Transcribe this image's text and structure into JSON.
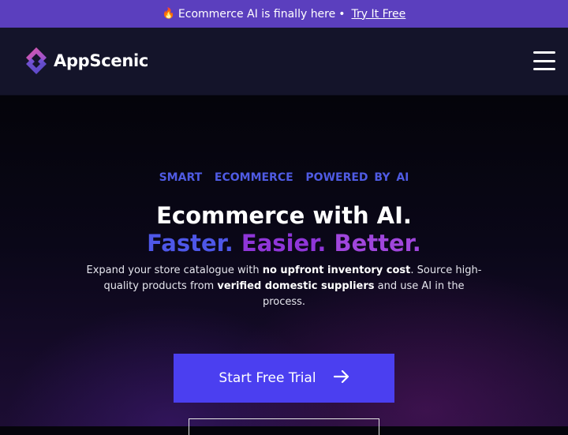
{
  "announcement": {
    "icon": "fire-icon",
    "text": "Ecommerce AI is finally here",
    "separator": "•",
    "link": "Try It Free"
  },
  "nav": {
    "brand": "AppScenic",
    "menu_icon": "hamburger-menu-icon"
  },
  "hero": {
    "eyebrow": "SMART  ECOMMERCE  POWERED BY AI",
    "headline": "Ecommerce with AI.",
    "tagline_1": "Faster.",
    "tagline_2": "Easier.",
    "tagline_3": "Better.",
    "desc_1": "Expand your store catalogue with ",
    "desc_bold_1": "no upfront inventory cost",
    "desc_2": ". Source high-quality products from ",
    "desc_bold_2": "verified domestic suppliers",
    "desc_3": " and use AI in the process.",
    "cta_label": "Start Free Trial",
    "cta_icon": "arrow-right-icon"
  },
  "colors": {
    "announce_bg": "#5b3fbe",
    "nav_bg": "#14142a",
    "accent_blue": "#4e57e8",
    "accent_purple": "#8f36d8",
    "cta_bg": "#4b3ff0"
  }
}
